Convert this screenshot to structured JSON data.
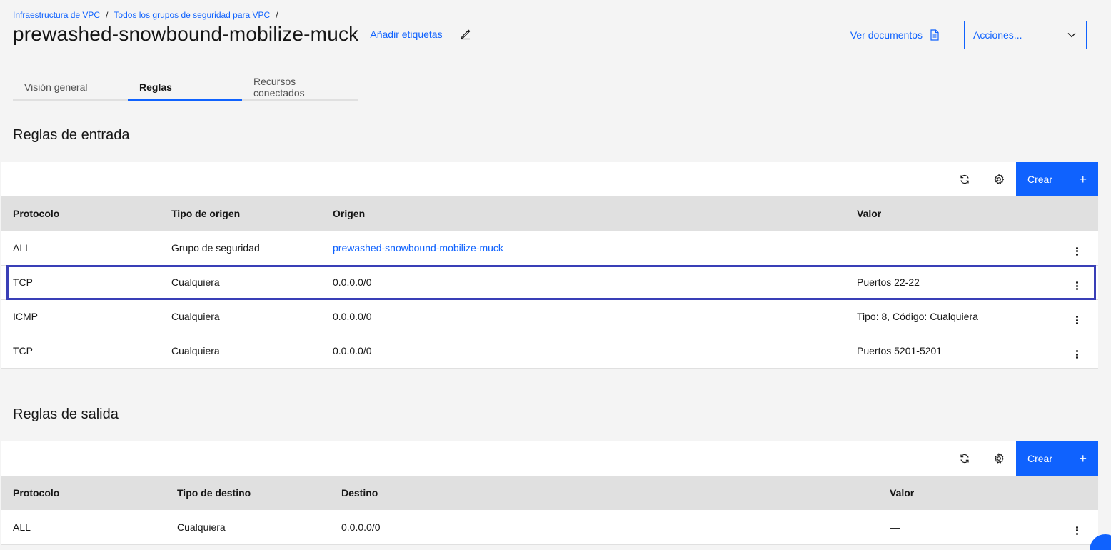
{
  "breadcrumb": [
    {
      "label": "Infraestructura de VPC"
    },
    {
      "label": "Todos los grupos de seguridad para VPC"
    }
  ],
  "breadcrumb_separator": "/",
  "header": {
    "title": "prewashed-snowbound-mobilize-muck",
    "add_tags": "Añadir etiquetas",
    "docs_link": "Ver documentos",
    "actions": "Acciones..."
  },
  "tabs": [
    {
      "label": "Visión general"
    },
    {
      "label": "Reglas",
      "active": true
    },
    {
      "label": "Recursos conectados"
    }
  ],
  "inbound": {
    "title": "Reglas de entrada",
    "create_label": "Crear",
    "columns": [
      "Protocolo",
      "Tipo de origen",
      "Origen",
      "Valor"
    ],
    "rows": [
      [
        "ALL",
        "Grupo de seguridad",
        "prewashed-snowbound-mobilize-muck",
        "—"
      ],
      [
        "TCP",
        "Cualquiera",
        "0.0.0.0/0",
        "Puertos 22-22"
      ],
      [
        "ICMP",
        "Cualquiera",
        "0.0.0.0/0",
        "Tipo: 8, Código: Cualquiera"
      ],
      [
        "TCP",
        "Cualquiera",
        "0.0.0.0/0",
        "Puertos 5201-5201"
      ]
    ]
  },
  "outbound": {
    "title": "Reglas de salida",
    "create_label": "Crear",
    "columns": [
      "Protocolo",
      "Tipo de destino",
      "Destino",
      "Valor"
    ],
    "rows": [
      [
        "ALL",
        "Cualquiera",
        "0.0.0.0/0",
        "—"
      ]
    ]
  },
  "icons": {
    "edit": "pencil-icon",
    "docs": "document-icon",
    "dropdown": "chevron-down-icon",
    "refresh": "refresh-icon",
    "settings": "gear-icon",
    "add": "plus-icon",
    "row_menu": "overflow-menu-icon"
  },
  "colors": {
    "accent": "#0f62fe",
    "highlight": "#393fb7",
    "background": "#f4f4f4",
    "header_row": "#e0e0e0"
  }
}
